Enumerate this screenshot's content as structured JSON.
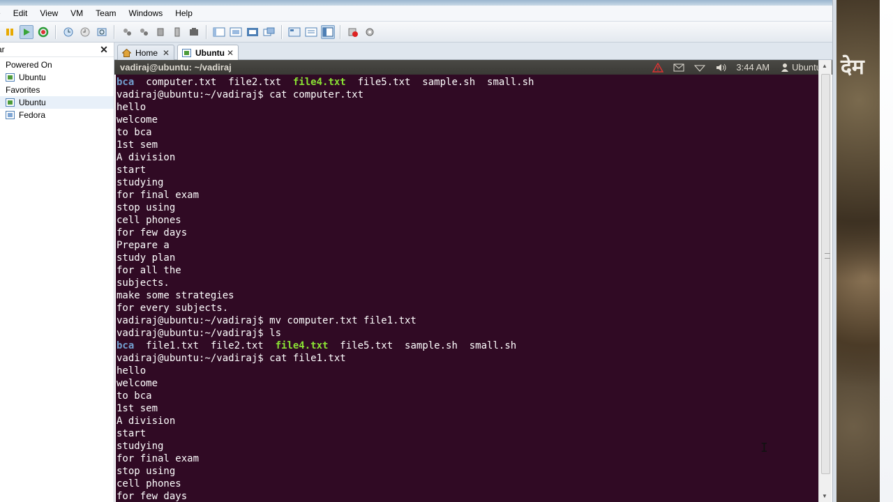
{
  "menubar": {
    "items": [
      "e",
      "Edit",
      "View",
      "VM",
      "Team",
      "Windows",
      "Help"
    ]
  },
  "toolbar": {
    "icons": [
      "pause-icon",
      "play-icon",
      "reset-icon",
      "snapshot-take-icon",
      "snapshot-revert-icon",
      "snapshot-manager-icon",
      "network-icon",
      "network-2-icon",
      "network-3-icon",
      "usb-icon",
      "capture-icon",
      "view-normal-icon",
      "view-fit-icon",
      "view-full-icon",
      "view-unity-icon",
      "console-icon",
      "quick-switch-icon",
      "library-icon",
      "stop-icon",
      "settings-icon"
    ]
  },
  "sidebar": {
    "title": "ar",
    "close_label": "✕",
    "groups": [
      {
        "label": "Powered On",
        "items": [
          "Ubuntu"
        ]
      },
      {
        "label": "Favorites",
        "items": [
          "Ubuntu",
          "Fedora"
        ]
      }
    ]
  },
  "tabs": [
    {
      "label": "Home",
      "icon": "home-icon",
      "close": "✕",
      "active": false
    },
    {
      "label": "Ubuntu",
      "icon": "vm-icon",
      "close": "✕",
      "active": true
    }
  ],
  "guest": {
    "window_title": "vadiraj@ubuntu: ~/vadiraj",
    "clock": "3:44 AM",
    "user": "Ubuntu"
  },
  "terminal": {
    "bg_color": "#300a24",
    "dir_color": "#729fcf",
    "exec_color": "#8ae234",
    "lines": [
      [
        {
          "t": "bca",
          "c": "blue"
        },
        {
          "t": "  computer.txt  file2.txt  ",
          "c": ""
        },
        {
          "t": "file4.txt",
          "c": "green"
        },
        {
          "t": "  file5.txt  sample.sh  small.sh",
          "c": ""
        }
      ],
      [
        {
          "t": "vadiraj@ubuntu:~/vadiraj$ cat computer.txt",
          "c": ""
        }
      ],
      [
        {
          "t": "hello",
          "c": ""
        }
      ],
      [
        {
          "t": "welcome",
          "c": ""
        }
      ],
      [
        {
          "t": "to bca",
          "c": ""
        }
      ],
      [
        {
          "t": "1st sem",
          "c": ""
        }
      ],
      [
        {
          "t": "A division",
          "c": ""
        }
      ],
      [
        {
          "t": "start",
          "c": ""
        }
      ],
      [
        {
          "t": "studying",
          "c": ""
        }
      ],
      [
        {
          "t": "for final exam",
          "c": ""
        }
      ],
      [
        {
          "t": "stop using",
          "c": ""
        }
      ],
      [
        {
          "t": "cell phones",
          "c": ""
        }
      ],
      [
        {
          "t": "for few days",
          "c": ""
        }
      ],
      [
        {
          "t": "Prepare a",
          "c": ""
        }
      ],
      [
        {
          "t": "study plan",
          "c": ""
        }
      ],
      [
        {
          "t": "for all the",
          "c": ""
        }
      ],
      [
        {
          "t": "subjects.",
          "c": ""
        }
      ],
      [
        {
          "t": "make some strategies",
          "c": ""
        }
      ],
      [
        {
          "t": "for every subjects.",
          "c": ""
        }
      ],
      [
        {
          "t": "vadiraj@ubuntu:~/vadiraj$ mv computer.txt file1.txt",
          "c": ""
        }
      ],
      [
        {
          "t": "vadiraj@ubuntu:~/vadiraj$ ls",
          "c": ""
        }
      ],
      [
        {
          "t": "bca",
          "c": "blue"
        },
        {
          "t": "  file1.txt  file2.txt  ",
          "c": ""
        },
        {
          "t": "file4.txt",
          "c": "green"
        },
        {
          "t": "  file5.txt  sample.sh  small.sh",
          "c": ""
        }
      ],
      [
        {
          "t": "vadiraj@ubuntu:~/vadiraj$ cat file1.txt",
          "c": ""
        }
      ],
      [
        {
          "t": "hello",
          "c": ""
        }
      ],
      [
        {
          "t": "welcome",
          "c": ""
        }
      ],
      [
        {
          "t": "to bca",
          "c": ""
        }
      ],
      [
        {
          "t": "1st sem",
          "c": ""
        }
      ],
      [
        {
          "t": "A division",
          "c": ""
        }
      ],
      [
        {
          "t": "start",
          "c": ""
        }
      ],
      [
        {
          "t": "studying",
          "c": ""
        }
      ],
      [
        {
          "t": "for final exam",
          "c": ""
        }
      ],
      [
        {
          "t": "stop using",
          "c": ""
        }
      ],
      [
        {
          "t": "cell phones",
          "c": ""
        }
      ],
      [
        {
          "t": "for few days",
          "c": ""
        }
      ]
    ]
  },
  "desktop": {
    "text": "देम"
  }
}
